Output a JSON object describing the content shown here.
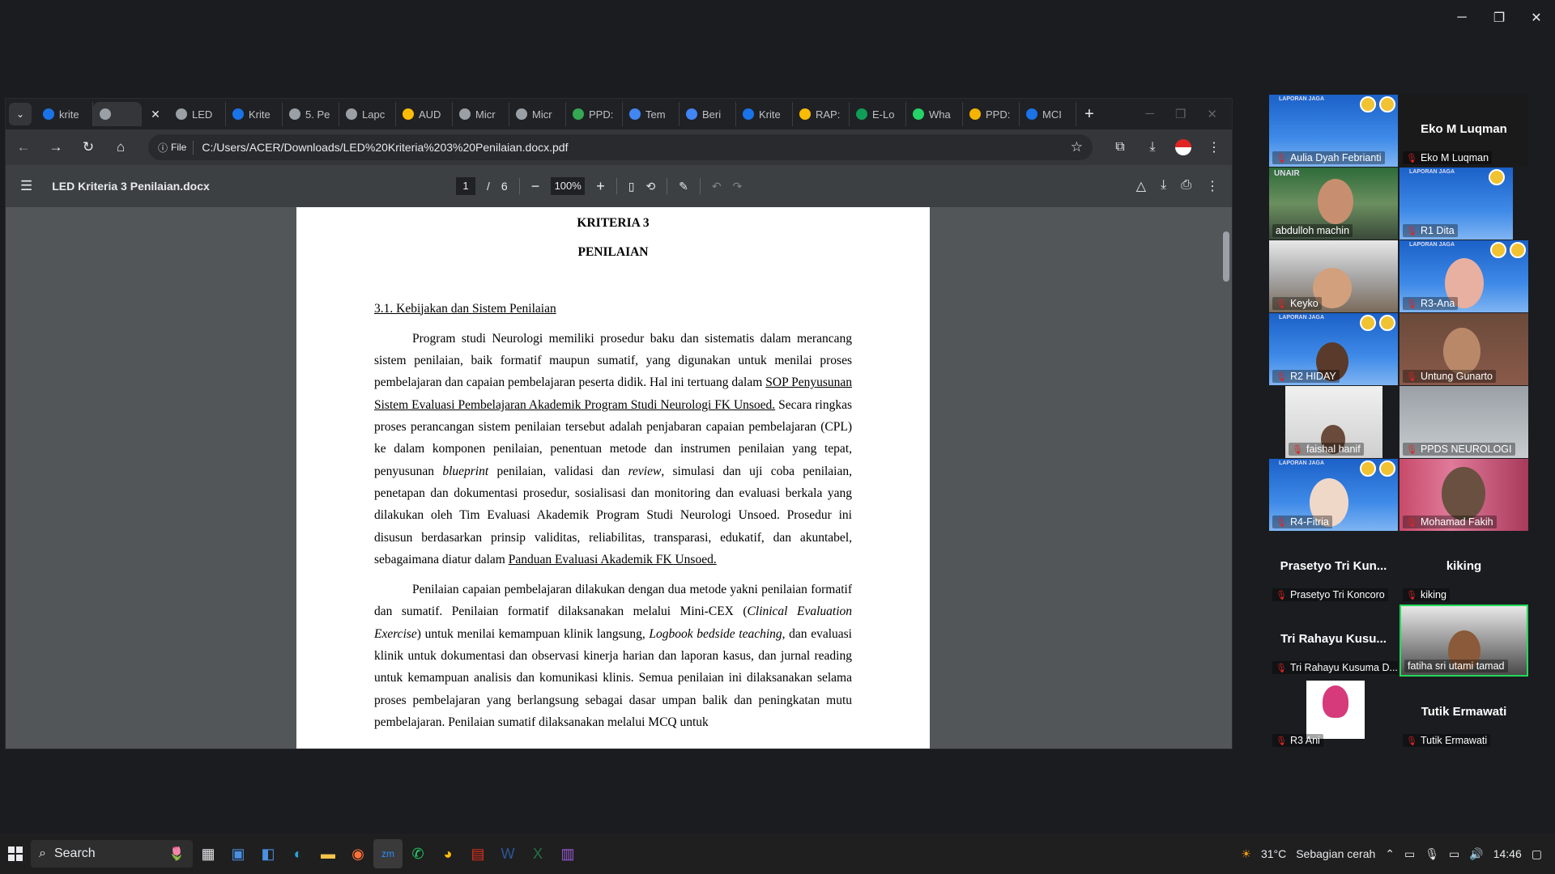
{
  "window_controls": {
    "minimize": "─",
    "restore": "❐",
    "close": "✕"
  },
  "browser": {
    "tabs": [
      {
        "label": "krite",
        "color": "#1a73e8"
      },
      {
        "label": "",
        "color": "#9aa0a6",
        "active": true
      },
      {
        "label": "LED",
        "color": "#9aa0a6"
      },
      {
        "label": "Krite",
        "color": "#1a73e8"
      },
      {
        "label": "5. Pe",
        "color": "#9aa0a6"
      },
      {
        "label": "Lapc",
        "color": "#9aa0a6"
      },
      {
        "label": "AUD",
        "color": "#fbbc04"
      },
      {
        "label": "Micr",
        "color": "#9aa0a6"
      },
      {
        "label": "Micr",
        "color": "#9aa0a6"
      },
      {
        "label": "PPD:",
        "color": "#34a853"
      },
      {
        "label": "Tem",
        "color": "#4285f4"
      },
      {
        "label": "Beri",
        "color": "#4285f4"
      },
      {
        "label": "Krite",
        "color": "#1a73e8"
      },
      {
        "label": "RAP:",
        "color": "#fbbc04"
      },
      {
        "label": "E-Lo",
        "color": "#0f9d58"
      },
      {
        "label": "Wha",
        "color": "#25d366"
      },
      {
        "label": "PPD:",
        "color": "#f4b400"
      },
      {
        "label": "MCI",
        "color": "#1a73e8"
      }
    ],
    "file_chip": "File",
    "url": "C:/Users/ACER/Downloads/LED%20Kriteria%203%20Penilaian.docx.pdf"
  },
  "pdf": {
    "title": "LED Kriteria 3 Penilaian.docx",
    "page_current": "1",
    "page_sep": "/",
    "page_total": "6",
    "zoom": "100%",
    "zoom_out": "−",
    "zoom_in": "+"
  },
  "doc": {
    "h1": "KRITERIA 3",
    "h2": "PENILAIAN",
    "section": "3.1. Kebijakan dan Sistem Penilaian",
    "p1_a": "Program studi Neurologi memiliki prosedur baku dan sistematis dalam merancang sistem penilaian, baik formatif maupun sumatif, yang digunakan untuk menilai proses pembelajaran dan capaian pembelajaran peserta didik. Hal ini tertuang dalam ",
    "p1_link": "SOP Penyusunan Sistem Evaluasi Pembelajaran Akademik Program Studi Neurologi FK Unsoed.",
    "p1_b": " Secara ringkas proses perancangan sistem penilaian tersebut adalah penjabaran capaian pembelajaran (CPL) ke dalam komponen penilaian, penentuan metode dan instrumen penilaian yang tepat, penyusunan ",
    "p1_i1": "blueprint",
    "p1_c": " penilaian, validasi dan ",
    "p1_i2": "review",
    "p1_d": ", simulasi dan uji coba penilaian, penetapan dan dokumentasi prosedur, sosialisasi dan monitoring dan evaluasi berkala yang dilakukan oleh Tim Evaluasi Akademik Program Studi Neurologi Unsoed. Prosedur ini disusun berdasarkan prinsip validitas, reliabilitas, transparasi, edukatif, dan akuntabel, sebagaimana diatur dalam ",
    "p1_link2": "Panduan Evaluasi Akademik FK Unsoed.",
    "p2_a": "Penilaian capaian pembelajaran dilakukan dengan dua metode yakni penilaian formatif dan sumatif. Penilaian formatif dilaksanakan melalui Mini-CEX (",
    "p2_i1": "Clinical Evaluation Exercise",
    "p2_b": ") untuk menilai kemampuan klinik langsung, ",
    "p2_i2": "Logbook bedside teaching",
    "p2_c": ", dan evaluasi klinik untuk dokumentasi dan observasi kinerja harian dan laporan kasus, dan jurnal reading untuk kemampuan analisis dan komunikasi klinis. Semua penilaian ini dilaksanakan selama proses pembelajaran yang berlangsung sebagai dasar umpan balik dan peningkatan mutu pembelajaran. Penilaian sumatif dilaksanakan melalui MCQ untuk"
  },
  "participants": {
    "t1": "Aulia Dyah Febrianti",
    "t2_big": "Eko M Luqman",
    "t2": "Eko M Luqman",
    "t3": "abdulloh machin",
    "t4": "R1 Dita",
    "t5": "Keyko",
    "t6": "R3-Ana",
    "t7": "R2 HIDAY",
    "t8": "Untung Gunarto",
    "t9": "faishal hanif",
    "t10": "PPDS NEUROLOGI",
    "t11": "R4-Fitria",
    "t12": "Mohamad Fakih",
    "t13_big": "Prasetyo Tri Kun...",
    "t13": "Prasetyo Tri Koncoro",
    "t14_big": "kiking",
    "t14": "kiking",
    "t15_big": "Tri Rahayu Kusu...",
    "t15": "Tri Rahayu Kusuma D...",
    "t16": "fatiha sri utami tamad",
    "t17": "R3 Ani",
    "t18_big": "Tutik Ermawati",
    "t18": "Tutik Ermawati",
    "lapjaga": "LAPORAN JAGA",
    "unair": "UNAIR"
  },
  "taskbar": {
    "search": "Search",
    "temp": "31°C",
    "weather": "Sebagian cerah",
    "time": "14:46"
  }
}
